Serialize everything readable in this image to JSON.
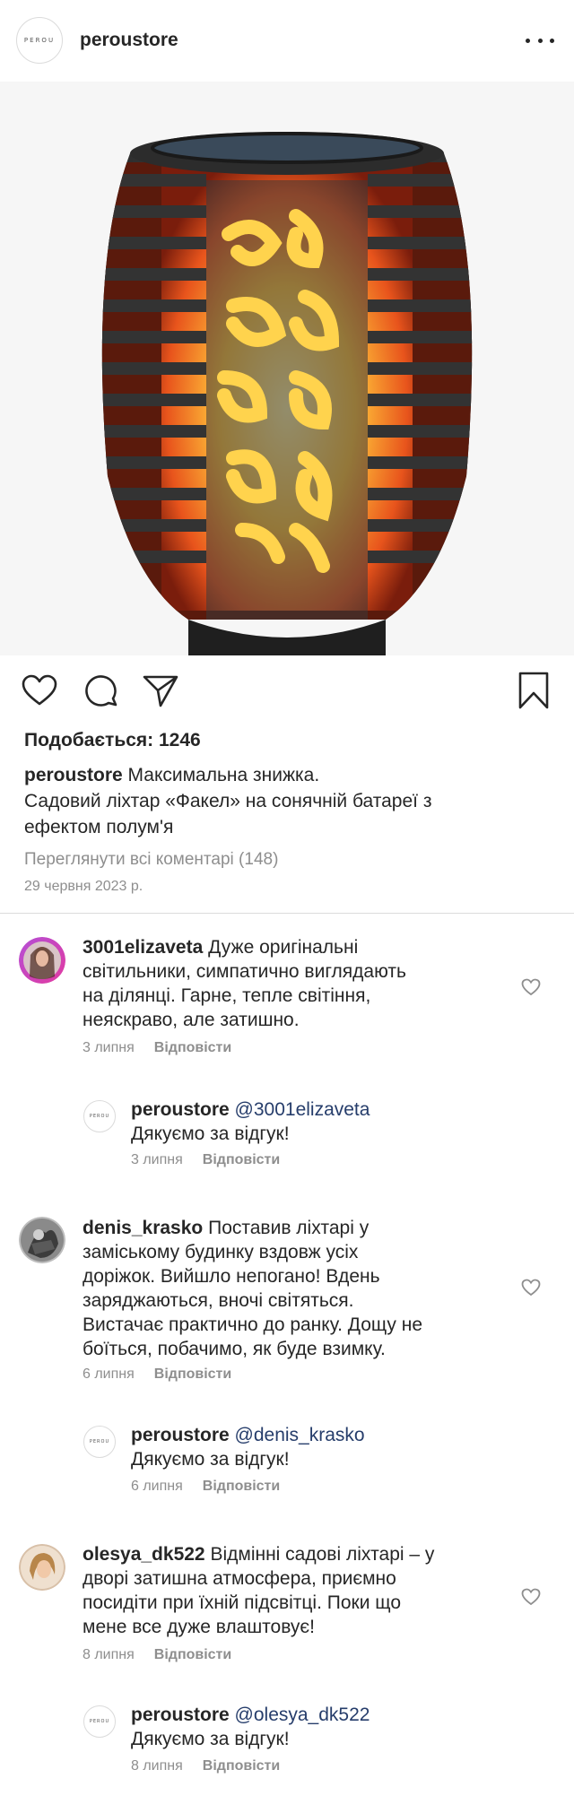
{
  "header": {
    "avatar_text": "PEROU",
    "username": "peroustore"
  },
  "post": {
    "image_alt_icon": "solar-torch-lantern-photo",
    "likes_label": "Подобається: 1246",
    "caption_user": "peroustore",
    "caption_line1": "Максимальна знижка.",
    "caption_line2": "Садовий ліхтар «Факел» на сонячній батареї з",
    "caption_line3": "ефектом полум'я",
    "view_all": "Переглянути всі коментарі (148)",
    "date": "29 червня 2023 р."
  },
  "reply_label": "Відповісти",
  "comments": [
    {
      "user": "3001elizaveta",
      "lines": [
        "Дуже оригінальні",
        "світильники, симпатично виглядають",
        "на ділянці. Гарне, тепле світіння,",
        "неяскраво, але затишно."
      ],
      "date": "3 липня",
      "reply": {
        "user": "peroustore",
        "mention": "@3001elizaveta",
        "text": "Дякуємо за відгук!",
        "date": "3 липня"
      }
    },
    {
      "user": "denis_krasko",
      "lines": [
        "Поставив ліхтарі у",
        "заміському будинку вздовж усіх",
        "доріжок. Вийшло непогано! Вдень",
        "заряджаються, вночі світяться.",
        "Вистачає практично до ранку. Дощу не",
        "боїться, побачимо, як буде взимку."
      ],
      "date": "6 липня",
      "reply": {
        "user": "peroustore",
        "mention": "@denis_krasko",
        "text": "Дякуємо за відгук!",
        "date": "6 липня"
      }
    },
    {
      "user": "olesya_dk522",
      "lines": [
        "Відмінні садові ліхтарі – у",
        "дворі затишна атмосфера, приємно",
        "посидіти при їхній підсвітці. Поки що",
        "мене все дуже влаштовує!"
      ],
      "date": "8 липня",
      "reply": {
        "user": "peroustore",
        "mention": "@olesya_dk522",
        "text": "Дякуємо за відгук!",
        "date": "8 липня"
      }
    }
  ]
}
